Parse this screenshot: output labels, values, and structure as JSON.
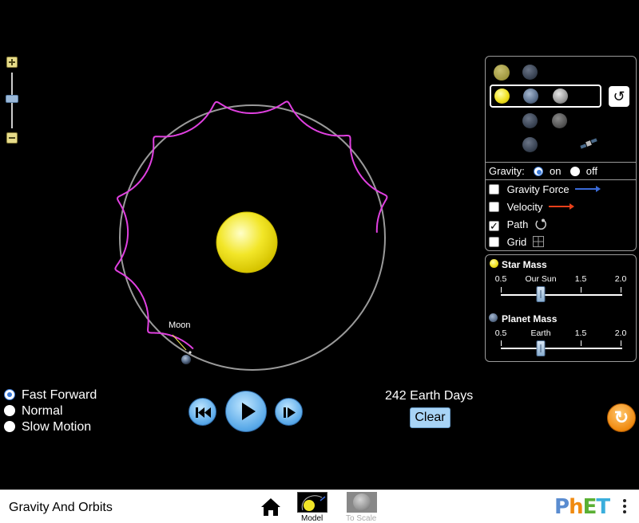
{
  "simulation": {
    "title": "Gravity And Orbits",
    "moon_label": "Moon",
    "elapsed_time": "242 Earth Days",
    "clear_label": "Clear"
  },
  "body_panel": {
    "gravity_label": "Gravity:",
    "gravity_options": [
      {
        "label": "on",
        "selected": true
      },
      {
        "label": "off",
        "selected": false
      }
    ],
    "checkboxes": [
      {
        "label": "Gravity Force",
        "checked": false,
        "icon": "blue-arrow-icon"
      },
      {
        "label": "Velocity",
        "checked": false,
        "icon": "red-arrow-icon"
      },
      {
        "label": "Path",
        "checked": true,
        "icon": "path-icon"
      },
      {
        "label": "Grid",
        "checked": false,
        "icon": "grid-icon"
      }
    ]
  },
  "mass_panel": {
    "star": {
      "title": "Star Mass",
      "ticks": [
        "0.5",
        "Our Sun",
        "1.5",
        "2.0"
      ],
      "value": 1.0
    },
    "planet": {
      "title": "Planet Mass",
      "ticks": [
        "0.5",
        "Earth",
        "1.5",
        "2.0"
      ],
      "value": 1.0
    }
  },
  "speed": {
    "options": [
      {
        "label": "Fast Forward",
        "selected": true
      },
      {
        "label": "Normal",
        "selected": false
      },
      {
        "label": "Slow Motion",
        "selected": false
      }
    ]
  },
  "navbar": {
    "screens": [
      {
        "label": "Model",
        "active": true
      },
      {
        "label": "To Scale",
        "active": false
      }
    ],
    "logo": "PhET"
  },
  "colors": {
    "path": "#e040e0",
    "orbit": "#9a9a9a",
    "sun": "#f2e628",
    "accent": "#58a8e8",
    "reset_all": "#f08a10"
  }
}
